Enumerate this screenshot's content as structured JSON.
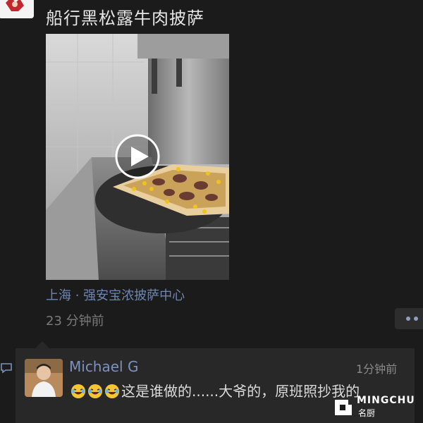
{
  "post": {
    "text": "船行黑松露牛肉披萨",
    "location": "上海 · 强安宝浓披萨中心",
    "time": "23 分钟前",
    "video_play_icon": "play-icon"
  },
  "comment": {
    "author": "Michael  G",
    "time": "1分钟前",
    "text": "这是谁做的......大爷的，原班照抄我的",
    "emojis": [
      "laughing-tears-emoji",
      "laughing-tears-emoji",
      "laughing-tears-emoji"
    ]
  },
  "watermark": {
    "brand_en": "MINGCHU",
    "brand_zh": "名厨"
  },
  "colors": {
    "background": "#1b1b1b",
    "link_blue": "#6e86b3",
    "name_blue": "#7d91bd",
    "comment_bg": "#282828"
  }
}
